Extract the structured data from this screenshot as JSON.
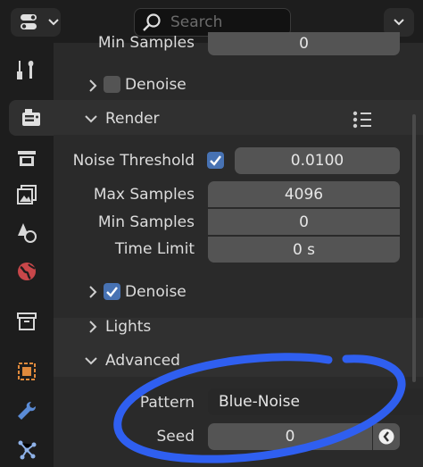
{
  "header": {
    "search_placeholder": "Search"
  },
  "sidebar": {
    "tabs": [
      {
        "name": "tool-tab",
        "icon": "wrench-screwdriver-icon"
      },
      {
        "name": "render-tab",
        "icon": "camera-back-icon",
        "active": true
      },
      {
        "name": "output-tab",
        "icon": "printer-icon"
      },
      {
        "name": "view-layer-tab",
        "icon": "image-stack-icon"
      },
      {
        "name": "scene-tab",
        "icon": "cone-sphere-icon"
      },
      {
        "name": "world-tab",
        "icon": "globe-icon"
      },
      {
        "name": "collection-tab",
        "icon": "box-icon"
      },
      {
        "name": "object-tab",
        "icon": "orange-square-icon"
      },
      {
        "name": "modifier-tab",
        "icon": "wrench-icon"
      },
      {
        "name": "particles-tab",
        "icon": "nodes-icon"
      }
    ]
  },
  "viewport": {
    "min_samples_label": "Min Samples",
    "min_samples_value": "0",
    "denoise_label": "Denoise",
    "denoise_checked": false
  },
  "render": {
    "title": "Render",
    "noise_threshold_label": "Noise Threshold",
    "noise_threshold_checked": true,
    "noise_threshold_value": "0.0100",
    "max_samples_label": "Max Samples",
    "max_samples_value": "4096",
    "min_samples_label": "Min Samples",
    "min_samples_value": "0",
    "time_limit_label": "Time Limit",
    "time_limit_value": "0 s",
    "denoise_label": "Denoise",
    "denoise_checked": true
  },
  "lights": {
    "title": "Lights"
  },
  "advanced": {
    "title": "Advanced",
    "pattern_label": "Pattern",
    "pattern_value": "Blue-Noise",
    "seed_label": "Seed",
    "seed_value": "0"
  },
  "colors": {
    "accent": "#4772b3",
    "annotation": "#2f5ff0",
    "panel": "#303030",
    "field": "#545454"
  }
}
